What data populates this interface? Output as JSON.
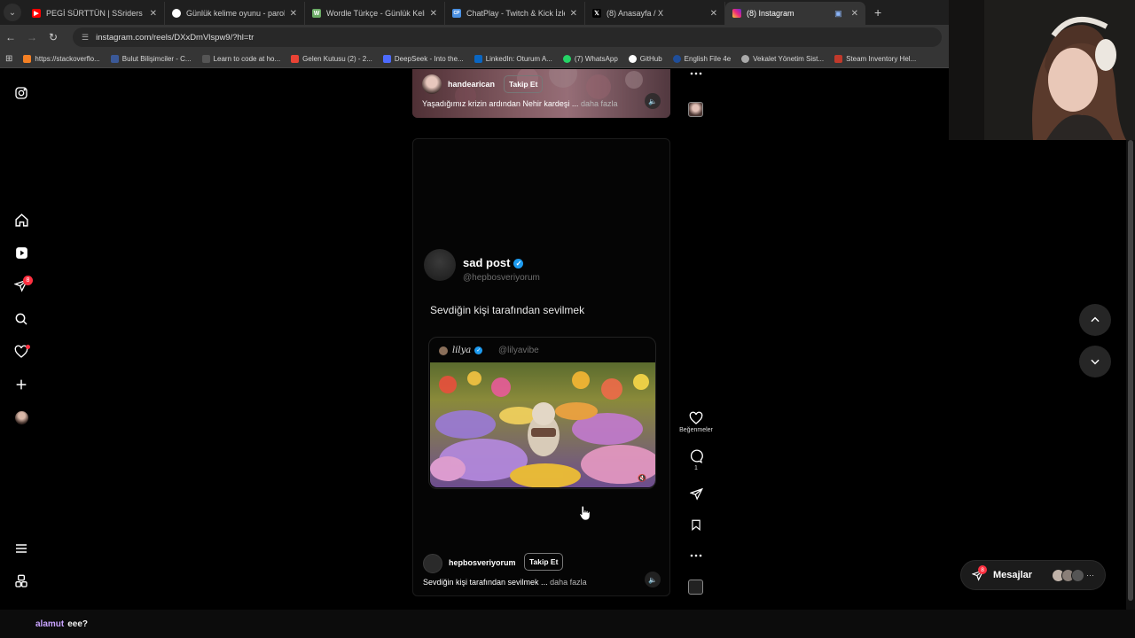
{
  "browser": {
    "tabs": [
      {
        "title": "PEGİ SÜRTTÜN | SSriders | Moto",
        "favicon": "youtube-icon",
        "color": "#ff0000",
        "active": false
      },
      {
        "title": "Günlük kelime oyunu - parolla",
        "favicon": "parolla-icon",
        "color": "#ffffff",
        "active": false
      },
      {
        "title": "Wordle Türkçe - Günlük Kelime",
        "favicon": "wordle-icon",
        "color": "#6aaa64",
        "active": false
      },
      {
        "title": "ChatPlay - Twitch & Kick İzleyici",
        "favicon": "chatplay-icon",
        "color": "#4a90e2",
        "active": false
      },
      {
        "title": "(8) Anasayfa / X",
        "favicon": "x-icon",
        "color": "#000000",
        "active": false
      },
      {
        "title": "(8) Instagram",
        "favicon": "instagram-icon",
        "color": "#e1306c",
        "active": true
      }
    ],
    "url": "instagram.com/reels/DXxDmVlspw9/?hl=tr",
    "bookmarks": [
      {
        "label": "https://stackoverflo...",
        "color": "#f48024"
      },
      {
        "label": "Bulut Bilişimciler - C...",
        "color": "#3b5998"
      },
      {
        "label": "Learn to code at ho...",
        "color": "#555555"
      },
      {
        "label": "Gelen Kutusu (2) - 2...",
        "color": "#ea4335"
      },
      {
        "label": "DeepSeek - Into the...",
        "color": "#4d6bfe"
      },
      {
        "label": "LinkedIn: Oturum A...",
        "color": "#0a66c2"
      },
      {
        "label": "(7) WhatsApp",
        "color": "#25d366"
      },
      {
        "label": "GitHub",
        "color": "#ffffff"
      },
      {
        "label": "English File 4e",
        "color": "#1f4e9a"
      },
      {
        "label": "Vekalet Yönetim Sist...",
        "color": "#aaaaaa"
      },
      {
        "label": "Steam Inventory Hel...",
        "color": "#c0392b"
      }
    ]
  },
  "sidenav": {
    "notifications_badge": "8"
  },
  "prev_reel": {
    "username": "handearican",
    "follow_label": "Takip Et",
    "caption": "Yaşadığımız krizin ardından Nehir kardeşi ...",
    "more_label": "daha fazla"
  },
  "reel": {
    "tweet": {
      "name": "sad post",
      "handle": "@hepbosveriyorum",
      "text": "Sevdiğin kişi tarafından sevilmek",
      "quote": {
        "name": "lilya",
        "handle": "@lilyavibe"
      }
    },
    "username": "hepbosveriyorum",
    "follow_label": "Takip Et",
    "caption": "Sevdiğin kişi tarafından sevilmek ...",
    "more_label": "daha fazla"
  },
  "actions": {
    "like_label": "Beğenmeler",
    "comment_count": "1"
  },
  "messages": {
    "label": "Mesajlar",
    "badge": "8"
  },
  "chat": {
    "user": "alamut",
    "message": "eee?"
  }
}
